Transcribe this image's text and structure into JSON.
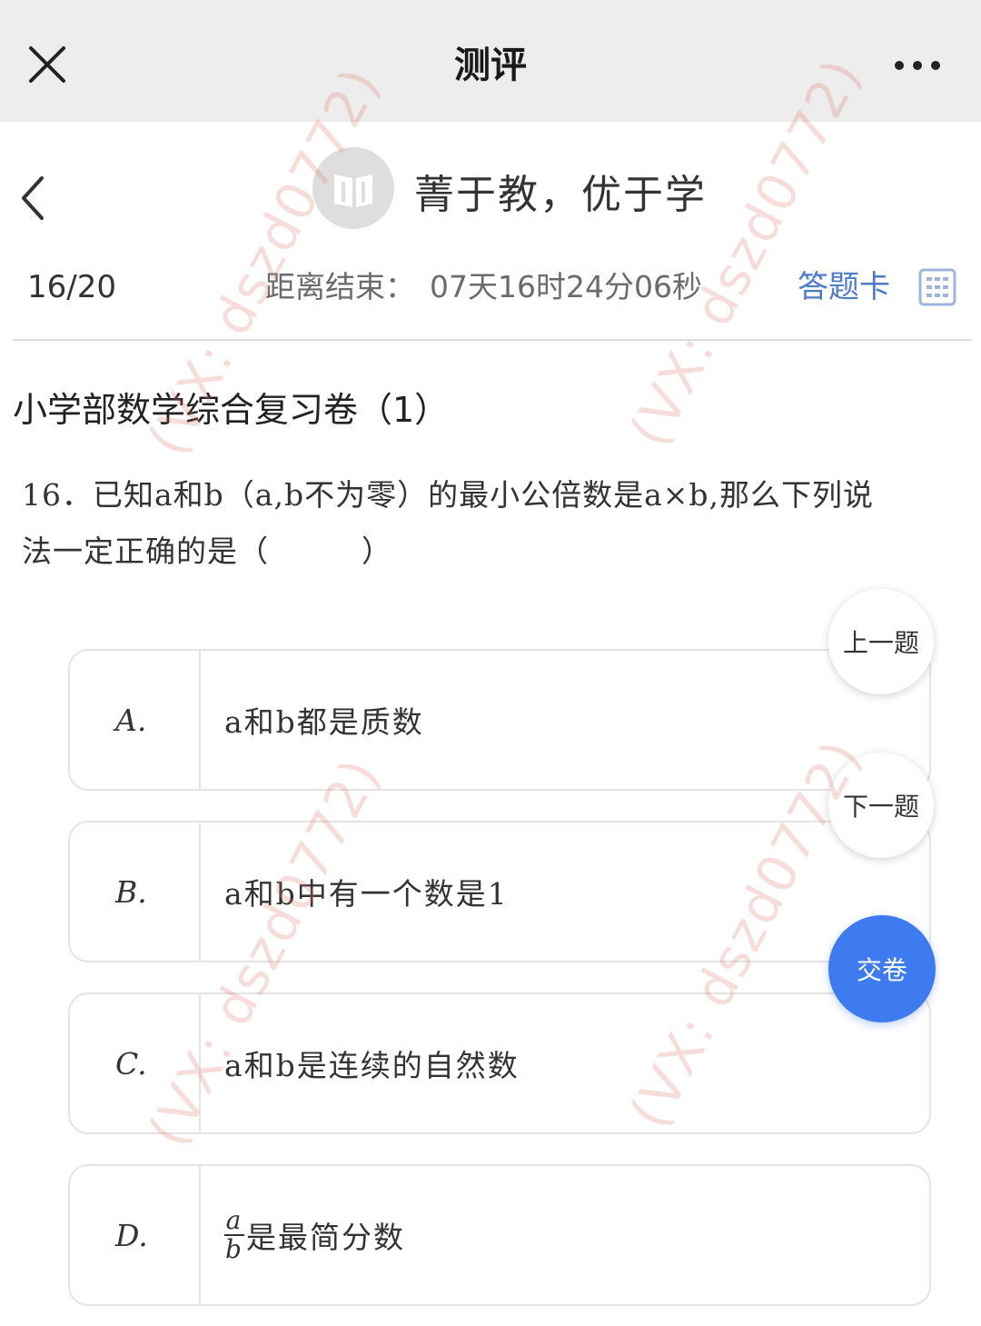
{
  "titlebar": {
    "title": "测评",
    "close_icon": "close-icon",
    "more_icon": "more-dots-icon"
  },
  "header": {
    "brand": "菁于教，优于学",
    "back_icon": "chevron-left-icon",
    "logo_icon": "book-logo-icon"
  },
  "status": {
    "progress": "16/20",
    "countdown_label": "距离结束：",
    "countdown_value": "07天16时24分06秒",
    "answer_card_label": "答题卡",
    "answer_card_icon": "grid-icon"
  },
  "paper": {
    "title": "小学部数学综合复习卷（1）"
  },
  "question": {
    "line1": "16．已知a和b（a,b不为零）的最小公倍数是a×b,那么下列说",
    "line2": "法一定正确的是（　　　）"
  },
  "options": [
    {
      "letter": "A.",
      "text": "a和b都是质数"
    },
    {
      "letter": "B.",
      "text": "a和b中有一个数是1"
    },
    {
      "letter": "C.",
      "text": "a和b是连续的自然数"
    },
    {
      "letter": "D.",
      "frac_num": "a",
      "frac_den": "b",
      "text": "是最简分数"
    }
  ],
  "nav": {
    "prev_label": "上一题",
    "next_label": "下一题",
    "submit_label": "交卷"
  },
  "watermark": "(VX: dszd0772)",
  "colors": {
    "accent": "#3e7bf0",
    "link": "#4b7bc9",
    "titlebar_bg": "#ededed"
  }
}
